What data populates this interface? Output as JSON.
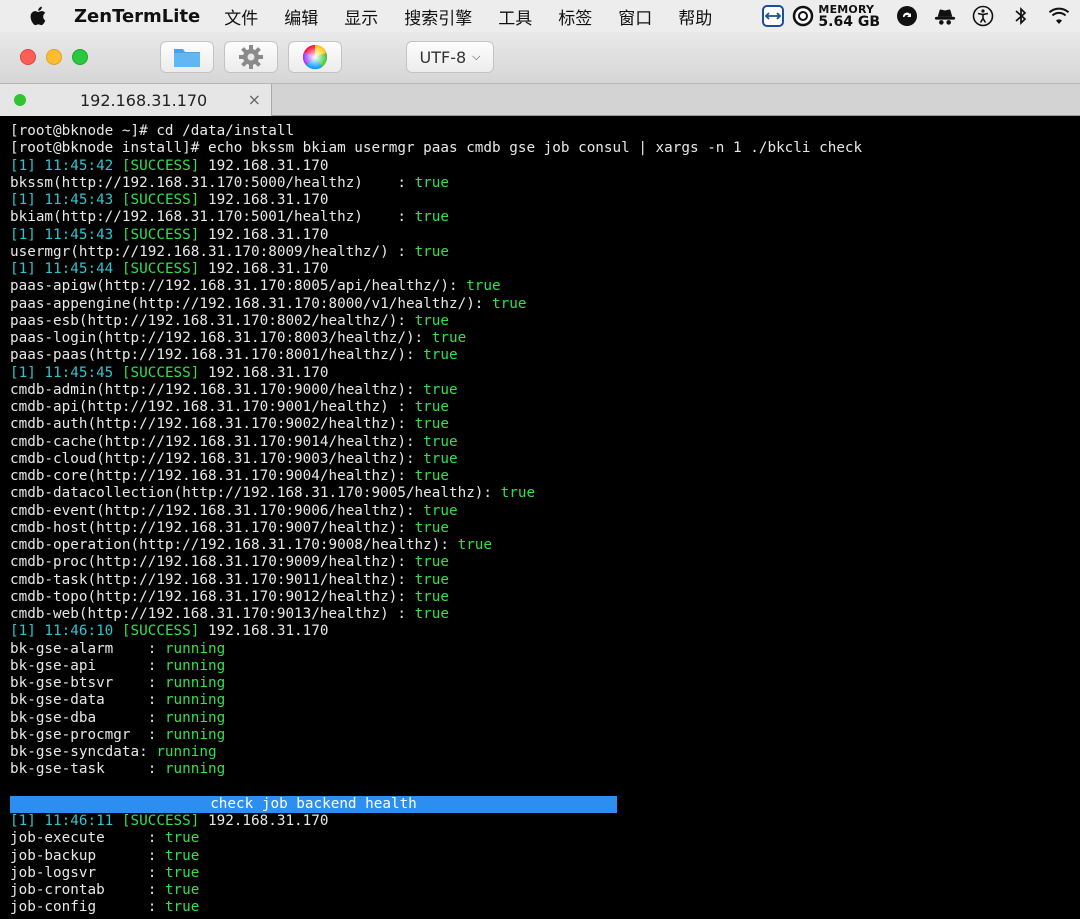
{
  "menubar": {
    "app_name": "ZenTermLite",
    "items": [
      "文件",
      "编辑",
      "显示",
      "搜索引擎",
      "工具",
      "标签",
      "窗口",
      "帮助"
    ],
    "memory_label": "MEMORY",
    "memory_value": "5.64 GB"
  },
  "toolbar": {
    "encoding": "UTF-8"
  },
  "tab": {
    "title": "192.168.31.170",
    "close": "×"
  },
  "terminal": {
    "lines": [
      [
        {
          "t": "[root@bknode ~]# cd /data/install",
          "c": "white"
        }
      ],
      [
        {
          "t": "[root@bknode install]# echo bkssm bkiam usermgr paas cmdb gse job consul | xargs -n 1 ./bkcli check",
          "c": "white"
        }
      ],
      [
        {
          "t": "[1] 11:45:42 ",
          "c": "cyan"
        },
        {
          "t": "[SUCCESS]",
          "c": "green"
        },
        {
          "t": " 192.168.31.170",
          "c": "white"
        }
      ],
      [
        {
          "t": "bkssm(http://192.168.31.170:5000/healthz)    : ",
          "c": "white"
        },
        {
          "t": "true",
          "c": "green"
        }
      ],
      [
        {
          "t": "[1] 11:45:43 ",
          "c": "cyan"
        },
        {
          "t": "[SUCCESS]",
          "c": "green"
        },
        {
          "t": " 192.168.31.170",
          "c": "white"
        }
      ],
      [
        {
          "t": "bkiam(http://192.168.31.170:5001/healthz)    : ",
          "c": "white"
        },
        {
          "t": "true",
          "c": "green"
        }
      ],
      [
        {
          "t": "[1] 11:45:43 ",
          "c": "cyan"
        },
        {
          "t": "[SUCCESS]",
          "c": "green"
        },
        {
          "t": " 192.168.31.170",
          "c": "white"
        }
      ],
      [
        {
          "t": "usermgr(http://192.168.31.170:8009/healthz/) : ",
          "c": "white"
        },
        {
          "t": "true",
          "c": "green"
        }
      ],
      [
        {
          "t": "[1] 11:45:44 ",
          "c": "cyan"
        },
        {
          "t": "[SUCCESS]",
          "c": "green"
        },
        {
          "t": " 192.168.31.170",
          "c": "white"
        }
      ],
      [
        {
          "t": "paas-apigw(http://192.168.31.170:8005/api/healthz/): ",
          "c": "white"
        },
        {
          "t": "true",
          "c": "green"
        }
      ],
      [
        {
          "t": "paas-appengine(http://192.168.31.170:8000/v1/healthz/): ",
          "c": "white"
        },
        {
          "t": "true",
          "c": "green"
        }
      ],
      [
        {
          "t": "paas-esb(http://192.168.31.170:8002/healthz/): ",
          "c": "white"
        },
        {
          "t": "true",
          "c": "green"
        }
      ],
      [
        {
          "t": "paas-login(http://192.168.31.170:8003/healthz/): ",
          "c": "white"
        },
        {
          "t": "true",
          "c": "green"
        }
      ],
      [
        {
          "t": "paas-paas(http://192.168.31.170:8001/healthz/): ",
          "c": "white"
        },
        {
          "t": "true",
          "c": "green"
        }
      ],
      [
        {
          "t": "[1] 11:45:45 ",
          "c": "cyan"
        },
        {
          "t": "[SUCCESS]",
          "c": "green"
        },
        {
          "t": " 192.168.31.170",
          "c": "white"
        }
      ],
      [
        {
          "t": "cmdb-admin(http://192.168.31.170:9000/healthz): ",
          "c": "white"
        },
        {
          "t": "true",
          "c": "green"
        }
      ],
      [
        {
          "t": "cmdb-api(http://192.168.31.170:9001/healthz) : ",
          "c": "white"
        },
        {
          "t": "true",
          "c": "green"
        }
      ],
      [
        {
          "t": "cmdb-auth(http://192.168.31.170:9002/healthz): ",
          "c": "white"
        },
        {
          "t": "true",
          "c": "green"
        }
      ],
      [
        {
          "t": "cmdb-cache(http://192.168.31.170:9014/healthz): ",
          "c": "white"
        },
        {
          "t": "true",
          "c": "green"
        }
      ],
      [
        {
          "t": "cmdb-cloud(http://192.168.31.170:9003/healthz): ",
          "c": "white"
        },
        {
          "t": "true",
          "c": "green"
        }
      ],
      [
        {
          "t": "cmdb-core(http://192.168.31.170:9004/healthz): ",
          "c": "white"
        },
        {
          "t": "true",
          "c": "green"
        }
      ],
      [
        {
          "t": "cmdb-datacollection(http://192.168.31.170:9005/healthz): ",
          "c": "white"
        },
        {
          "t": "true",
          "c": "green"
        }
      ],
      [
        {
          "t": "cmdb-event(http://192.168.31.170:9006/healthz): ",
          "c": "white"
        },
        {
          "t": "true",
          "c": "green"
        }
      ],
      [
        {
          "t": "cmdb-host(http://192.168.31.170:9007/healthz): ",
          "c": "white"
        },
        {
          "t": "true",
          "c": "green"
        }
      ],
      [
        {
          "t": "cmdb-operation(http://192.168.31.170:9008/healthz): ",
          "c": "white"
        },
        {
          "t": "true",
          "c": "green"
        }
      ],
      [
        {
          "t": "cmdb-proc(http://192.168.31.170:9009/healthz): ",
          "c": "white"
        },
        {
          "t": "true",
          "c": "green"
        }
      ],
      [
        {
          "t": "cmdb-task(http://192.168.31.170:9011/healthz): ",
          "c": "white"
        },
        {
          "t": "true",
          "c": "green"
        }
      ],
      [
        {
          "t": "cmdb-topo(http://192.168.31.170:9012/healthz): ",
          "c": "white"
        },
        {
          "t": "true",
          "c": "green"
        }
      ],
      [
        {
          "t": "cmdb-web(http://192.168.31.170:9013/healthz) : ",
          "c": "white"
        },
        {
          "t": "true",
          "c": "green"
        }
      ],
      [
        {
          "t": "[1] 11:46:10 ",
          "c": "cyan"
        },
        {
          "t": "[SUCCESS]",
          "c": "green"
        },
        {
          "t": " 192.168.31.170",
          "c": "white"
        }
      ],
      [
        {
          "t": "bk-gse-alarm    : ",
          "c": "white"
        },
        {
          "t": "running",
          "c": "green"
        }
      ],
      [
        {
          "t": "bk-gse-api      : ",
          "c": "white"
        },
        {
          "t": "running",
          "c": "green"
        }
      ],
      [
        {
          "t": "bk-gse-btsvr    : ",
          "c": "white"
        },
        {
          "t": "running",
          "c": "green"
        }
      ],
      [
        {
          "t": "bk-gse-data     : ",
          "c": "white"
        },
        {
          "t": "running",
          "c": "green"
        }
      ],
      [
        {
          "t": "bk-gse-dba      : ",
          "c": "white"
        },
        {
          "t": "running",
          "c": "green"
        }
      ],
      [
        {
          "t": "bk-gse-procmgr  : ",
          "c": "white"
        },
        {
          "t": "running",
          "c": "green"
        }
      ],
      [
        {
          "t": "bk-gse-syncdata: ",
          "c": "white"
        },
        {
          "t": "running",
          "c": "green"
        }
      ],
      [
        {
          "t": "bk-gse-task     : ",
          "c": "white"
        },
        {
          "t": "running",
          "c": "green"
        }
      ],
      [],
      [
        {
          "t": "check job backend health",
          "c": "banner"
        }
      ],
      [
        {
          "t": "[1] 11:46:11 ",
          "c": "cyan"
        },
        {
          "t": "[SUCCESS]",
          "c": "green"
        },
        {
          "t": " 192.168.31.170",
          "c": "white"
        }
      ],
      [
        {
          "t": "job-execute     : ",
          "c": "white"
        },
        {
          "t": "true",
          "c": "green"
        }
      ],
      [
        {
          "t": "job-backup      : ",
          "c": "white"
        },
        {
          "t": "true",
          "c": "green"
        }
      ],
      [
        {
          "t": "job-logsvr      : ",
          "c": "white"
        },
        {
          "t": "true",
          "c": "green"
        }
      ],
      [
        {
          "t": "job-crontab     : ",
          "c": "white"
        },
        {
          "t": "true",
          "c": "green"
        }
      ],
      [
        {
          "t": "job-config      : ",
          "c": "white"
        },
        {
          "t": "true",
          "c": "green"
        }
      ]
    ]
  },
  "colors": {
    "success": "#31e04a",
    "timestamp": "#2fc4cf",
    "banner": "#2b8ef0",
    "background": "#000000"
  }
}
